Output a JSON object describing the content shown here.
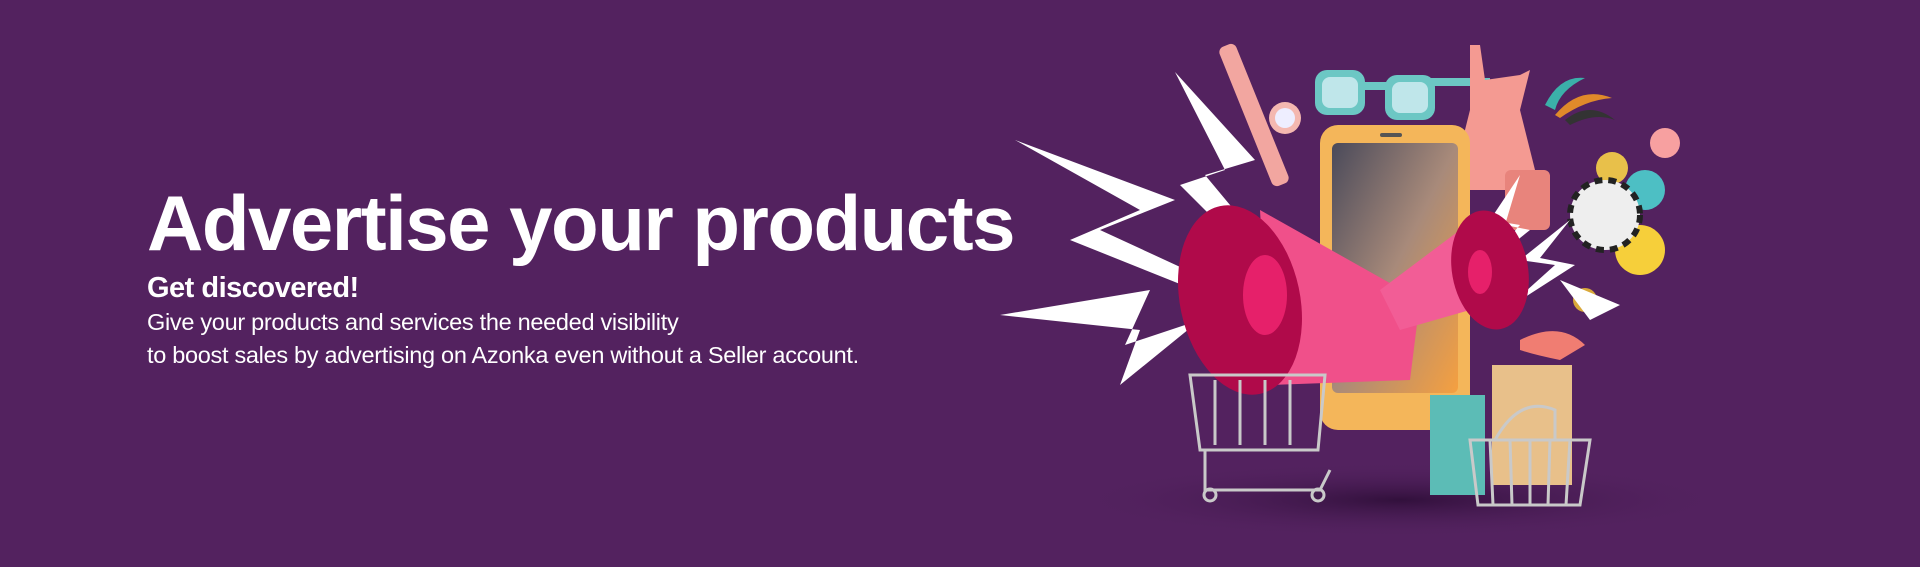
{
  "banner": {
    "title": "Advertise your products",
    "subtitle": "Get discovered!",
    "body_line1": "Give your products and services the needed visibility",
    "body_line2": "to boost sales by advertising on Azonka even without a Seller account.",
    "background_color": "#53225f",
    "illustration": "megaphones-phone-shopping-items"
  }
}
